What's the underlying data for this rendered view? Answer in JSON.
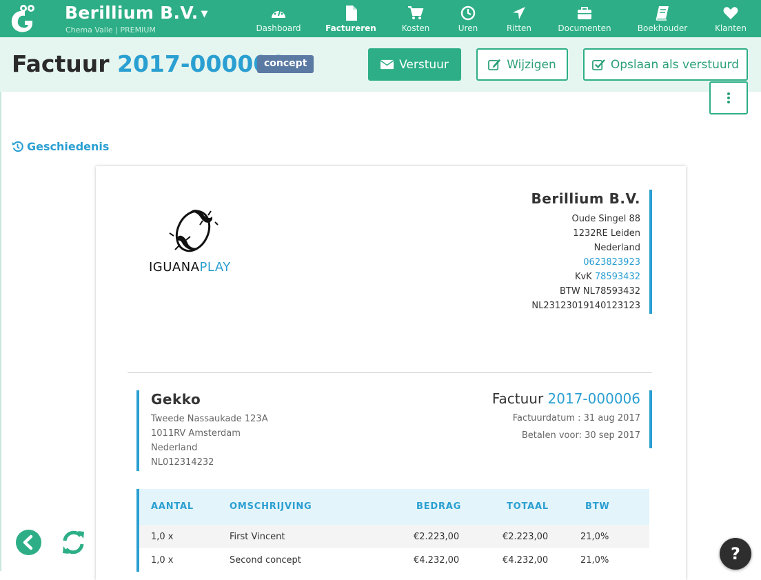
{
  "topbar": {
    "company": "Berillium B.V.",
    "subline": "Chema Valle | PREMIUM",
    "nav": [
      {
        "label": "Dashboard",
        "icon": "dashboard-icon"
      },
      {
        "label": "Factureren",
        "icon": "document-icon",
        "active": true
      },
      {
        "label": "Kosten",
        "icon": "cart-icon"
      },
      {
        "label": "Uren",
        "icon": "clock-icon"
      },
      {
        "label": "Ritten",
        "icon": "location-arrow-icon"
      },
      {
        "label": "Documenten",
        "icon": "briefcase-icon"
      },
      {
        "label": "Boekhouder",
        "icon": "book-icon"
      },
      {
        "label": "Klanten",
        "icon": "heart-icon"
      }
    ]
  },
  "header": {
    "title_prefix": "Factuur",
    "invoice_number": "2017-000006",
    "status_badge": "concept",
    "send_label": "Verstuur",
    "edit_label": "Wijzigen",
    "save_sent_label": "Opslaan als verstuurd"
  },
  "history_label": "Geschiedenis",
  "invoice": {
    "client_logo_text_a": "IGUANA",
    "client_logo_text_b": "PLAY",
    "sender": {
      "name": "Berillium B.V.",
      "street": "Oude Singel 88",
      "city": "1232RE Leiden",
      "country": "Nederland",
      "phone": "0623823923",
      "kvk_label": "KvK",
      "kvk_number": "78593432",
      "btw": "BTW NL78593432",
      "iban": "NL23123019140123123"
    },
    "client": {
      "name": "Gekko",
      "street": "Tweede Nassaukade 123A",
      "city": "1011RV Amsterdam",
      "country": "Nederland",
      "vat": "NL012314232"
    },
    "meta": {
      "title_prefix": "Factuur",
      "number": "2017-000006",
      "date": "Factuurdatum : 31 aug 2017",
      "due": "Betalen voor: 30 sep 2017"
    },
    "table": {
      "headers": [
        "AANTAL",
        "OMSCHRIJVING",
        "BEDRAG",
        "TOTAAL",
        "BTW"
      ],
      "rows": [
        [
          "1,0 x",
          "First Vincent",
          "€2.223,00",
          "€2.223,00",
          "21,0%"
        ],
        [
          "1,0 x",
          "Second concept",
          "€4.232,00",
          "€4.232,00",
          "21,0%"
        ]
      ]
    }
  },
  "help_label": "?",
  "colors": {
    "brand_green": "#2dae86",
    "link_blue": "#2a9fd1",
    "badge": "#5a7aa4"
  }
}
